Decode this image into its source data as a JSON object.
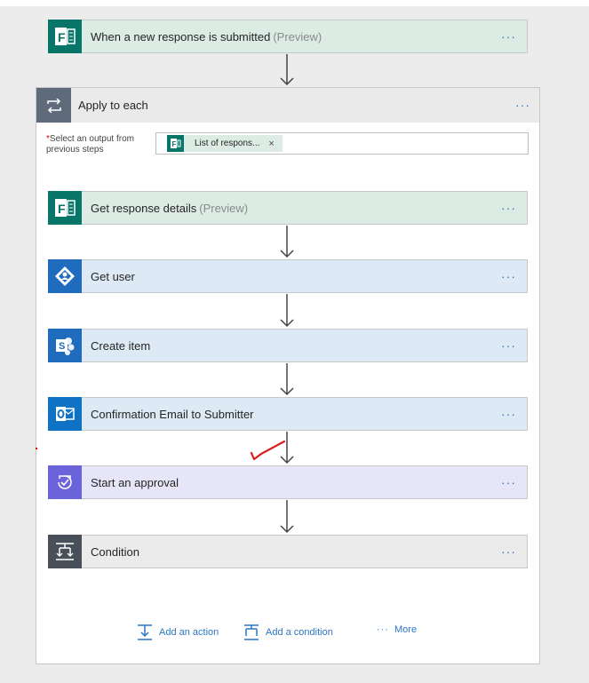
{
  "trigger": {
    "title": "When a new response is submitted",
    "suffix": "(Preview)",
    "icon": "forms-icon",
    "color": "#077568",
    "bg": "#dcebe4",
    "more": "···"
  },
  "apply_to_each": {
    "title": "Apply to each",
    "icon": "loop-icon",
    "more": "···",
    "select_label_required": "*",
    "select_label": "Select an output from previous steps",
    "token_text": "List of respons...",
    "token_close": "×"
  },
  "steps": [
    {
      "title": "Get response details",
      "suffix": "(Preview)",
      "icon": "forms-icon",
      "color": "#077568",
      "bg": "#dcebe4",
      "more": "···"
    },
    {
      "title": "Get user",
      "suffix": "",
      "icon": "azure-ad-icon",
      "color": "#1f6bbd",
      "bg": "#dde9f4",
      "more": "···"
    },
    {
      "title": "Create item",
      "suffix": "",
      "icon": "sharepoint-icon",
      "color": "#1f6bbd",
      "bg": "#dde9f4",
      "more": "···"
    },
    {
      "title": "Confirmation Email to Submitter",
      "suffix": "",
      "icon": "outlook-icon",
      "color": "#0f72c4",
      "bg": "#dde9f4",
      "more": "···"
    },
    {
      "title": "Start an approval",
      "suffix": "",
      "icon": "approval-icon",
      "color": "#6a63d9",
      "bg": "#e7e6f9",
      "more": "···"
    },
    {
      "title": "Condition",
      "suffix": "",
      "icon": "condition-icon",
      "color": "#484f58",
      "bg": "#ebebeb",
      "more": "···"
    }
  ],
  "footer": {
    "add_action": "Add an action",
    "add_condition": "Add a condition",
    "more_dots": "···",
    "more": "More"
  }
}
